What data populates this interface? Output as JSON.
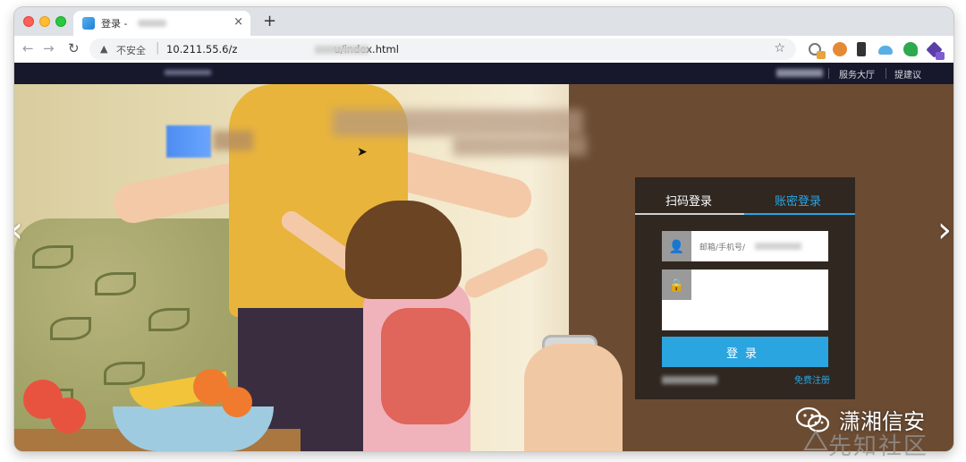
{
  "browser": {
    "tab_title": "登录 -",
    "tab_close": "×",
    "new_tab": "+",
    "nav_back": "←",
    "nav_forward": "→",
    "nav_reload": "↻",
    "security_warning_icon": "▲",
    "security_label": "不安全",
    "url_separator": "|",
    "url_text": "10.211.55.6/z",
    "url_suffix": "u/index.html",
    "bookmark_star": "☆"
  },
  "page": {
    "topnav": {
      "links": [
        "服务大厅",
        "提建议"
      ]
    },
    "carousel": {
      "prev_arrow": "‹",
      "next_arrow": "›"
    },
    "login": {
      "tab_qr": "扫码登录",
      "tab_account": "账密登录",
      "username_placeholder": "邮箱/手机号/",
      "login_button": "登录",
      "register_link": "免费注册"
    }
  },
  "watermark": {
    "title": "潇湘信安",
    "subtitle": "先知社区"
  },
  "colors": {
    "accent": "#2aa5e0",
    "topnav_bg": "#17182b",
    "panel_bg": "#28221e"
  }
}
